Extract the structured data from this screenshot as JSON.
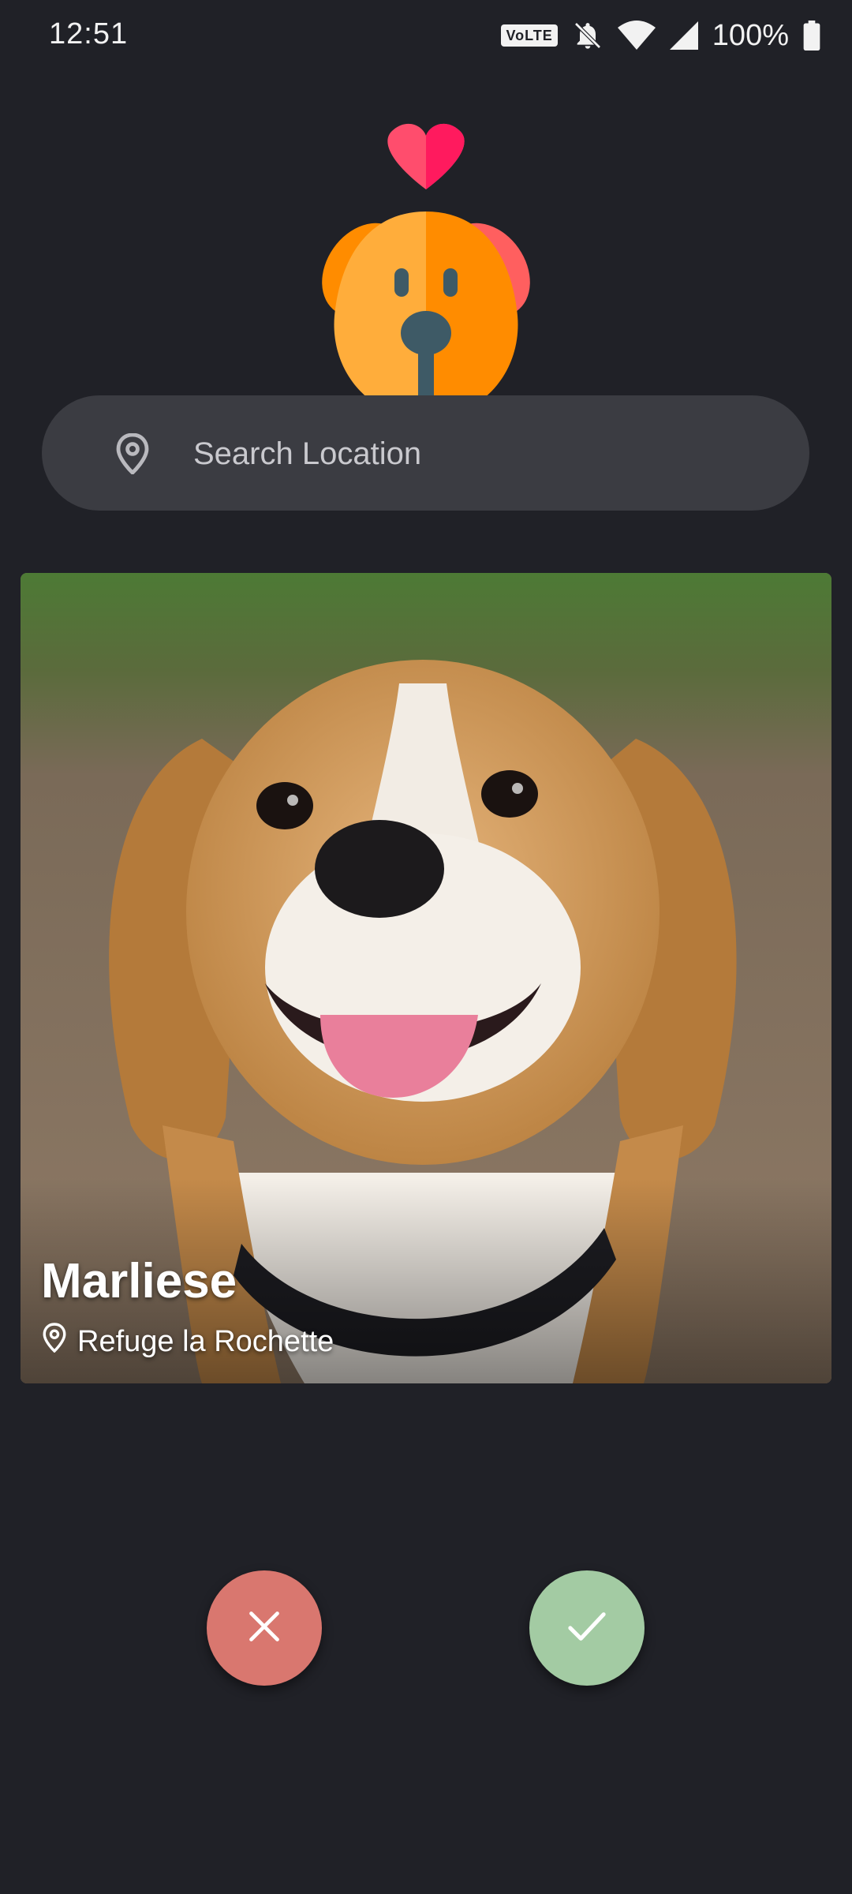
{
  "status_bar": {
    "time": "12:51",
    "volte": "VoLTE",
    "battery_text": "100%",
    "icons": [
      "volte-icon",
      "bell-off-icon",
      "wifi-icon",
      "signal-icon",
      "battery-icon"
    ]
  },
  "logo": {
    "icon": "dog-heart-logo-icon"
  },
  "search": {
    "placeholder": "Search Location",
    "value": "",
    "icon": "location-pin-icon"
  },
  "pet": {
    "name": "Marliese",
    "location": "Refuge la Rochette",
    "photo_icon": "beagle-photo"
  },
  "actions": {
    "reject_icon": "close-icon",
    "accept_icon": "check-icon"
  },
  "colors": {
    "background": "#202127",
    "search_bg": "#3b3c42",
    "reject": "#d9776f",
    "accept": "#a3cba3",
    "logo_orange": "#ff8c00",
    "logo_heart": "#ff2d6f"
  }
}
